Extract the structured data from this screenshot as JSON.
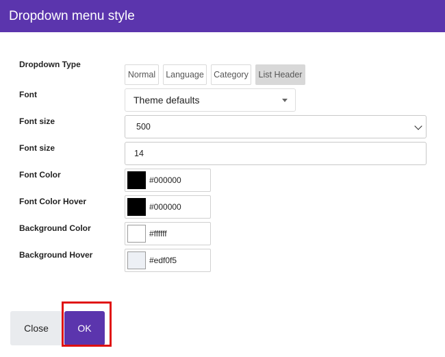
{
  "dialog": {
    "title": "Dropdown menu style"
  },
  "labels": {
    "dropdown_type": "Dropdown Type",
    "font": "Font",
    "font_size_weight": "Font size",
    "font_size": "Font size",
    "font_color": "Font Color",
    "font_color_hover": "Font Color Hover",
    "background_color": "Background Color",
    "background_hover": "Background Hover"
  },
  "dropdown_types": {
    "items": [
      {
        "label": "Normal"
      },
      {
        "label": "Language"
      },
      {
        "label": "Category"
      },
      {
        "label": "List Header"
      }
    ],
    "selected": "List Header"
  },
  "font": {
    "value": "Theme defaults"
  },
  "font_weight": {
    "value": "500"
  },
  "font_size": {
    "value": "14"
  },
  "colors": {
    "font_color": "#000000",
    "font_color_hover": "#000000",
    "background_color": "#ffffff",
    "background_hover": "#edf0f5"
  },
  "buttons": {
    "close": "Close",
    "ok": "OK"
  },
  "theme": {
    "accent": "#5b35ad",
    "highlight": "#e01010"
  }
}
